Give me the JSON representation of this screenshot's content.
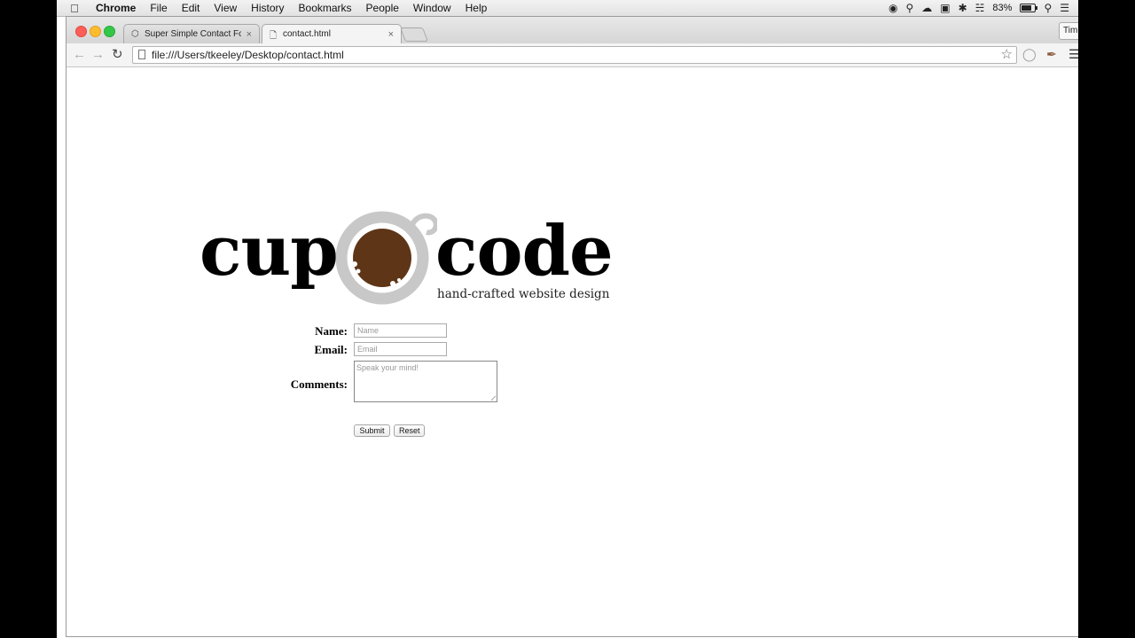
{
  "menubar": {
    "app_name": "Chrome",
    "menus": [
      "File",
      "Edit",
      "View",
      "History",
      "Bookmarks",
      "People",
      "Window",
      "Help"
    ],
    "battery_percent": "83%",
    "icons": [
      "apple-icon",
      "wifi-icon",
      "battery-icon",
      "search-icon",
      "list-icon"
    ]
  },
  "browser": {
    "tabs": [
      {
        "title": "Super Simple Contact Form",
        "active": false,
        "favicon": "codepen-icon"
      },
      {
        "title": "contact.html",
        "active": true,
        "favicon": "page-icon"
      }
    ],
    "profile_label": "Tim",
    "url": "file:///Users/tkeeley/Desktop/contact.html"
  },
  "page": {
    "logo": {
      "word_left": "cup",
      "word_right": "code",
      "tagline": "hand-crafted website design",
      "accent_color": "#5f3517",
      "ring_color": "#c8c8c8"
    },
    "form": {
      "name_label": "Name:",
      "name_placeholder": "Name",
      "email_label": "Email:",
      "email_placeholder": "Email",
      "comments_label": "Comments:",
      "comments_placeholder": "Speak your mind!",
      "submit_label": "Submit",
      "reset_label": "Reset"
    }
  }
}
